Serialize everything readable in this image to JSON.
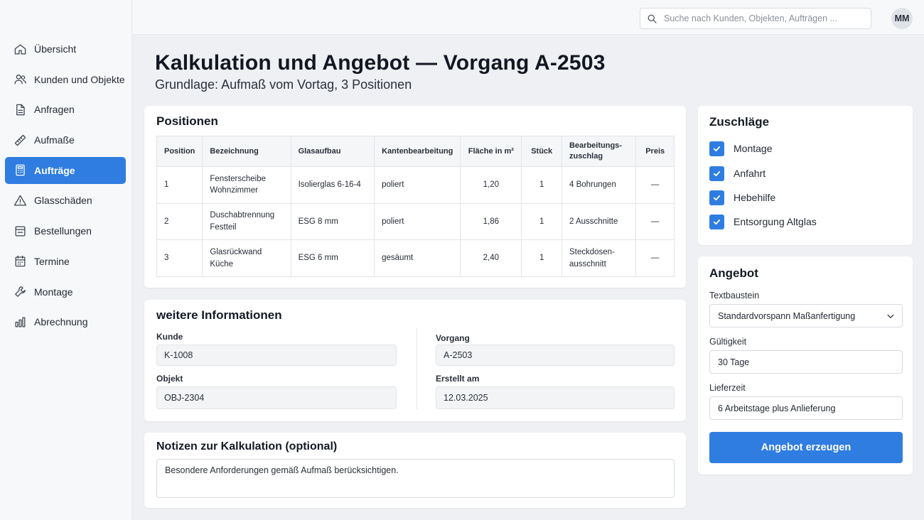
{
  "sidebar": {
    "items": [
      {
        "label": "Übersicht",
        "icon": "home-icon"
      },
      {
        "label": "Kunden und Objekte",
        "icon": "users-icon"
      },
      {
        "label": "Anfragen",
        "icon": "document-icon"
      },
      {
        "label": "Aufmaße",
        "icon": "ruler-icon"
      },
      {
        "label": "Aufträge",
        "icon": "calculator-icon",
        "active": true
      },
      {
        "label": "Glasschäden",
        "icon": "warning-icon"
      },
      {
        "label": "Bestellungen",
        "icon": "order-icon"
      },
      {
        "label": "Termine",
        "icon": "calendar-icon"
      },
      {
        "label": "Montage",
        "icon": "wrench-icon"
      },
      {
        "label": "Abrechnung",
        "icon": "bar-chart-icon"
      }
    ]
  },
  "topbar": {
    "search_placeholder": "Suche nach Kunden, Objekten, Aufträgen ...",
    "avatar_initials": "MM"
  },
  "header": {
    "title": "Kalkulation und Angebot — Vorgang A-2503",
    "subtitle": "Grundlage: Aufmaß vom Vortag, 3 Positionen"
  },
  "positions": {
    "title": "Positionen",
    "columns": [
      "Position",
      "Bezeichnung",
      "Glasaufbau",
      "Kantenbearbeitung",
      "Fläche in m²",
      "Stück",
      "Bearbeitungs-\nzuschlag",
      "Preis"
    ],
    "rows": [
      [
        "1",
        "Fensterscheibe\nWohnzimmer",
        "Isolierglas 6-16-4",
        "poliert",
        "1,20",
        "1",
        "4 Bohrungen",
        "—"
      ],
      [
        "2",
        "Duschabtrennung\nFestteil",
        "ESG 8 mm",
        "poliert",
        "1,86",
        "1",
        "2 Ausschnitte",
        "—"
      ],
      [
        "3",
        "Glasrückwand Küche",
        "ESG 6 mm",
        "gesäumt",
        "2,40",
        "1",
        "Steckdosen-\nausschnitt",
        "—"
      ]
    ]
  },
  "info": {
    "title": "weitere Informationen",
    "kunde_label": "Kunde",
    "kunde_value": "K-1008",
    "objekt_label": "Objekt",
    "objekt_value": "OBJ-2304",
    "vorgang_label": "Vorgang",
    "vorgang_value": "A-2503",
    "erstellt_label": "Erstellt am",
    "erstellt_value": "12.03.2025"
  },
  "notes": {
    "title": "Notizen zur Kalkulation (optional)",
    "value": "Besondere Anforderungen gemäß Aufmaß berücksichtigen."
  },
  "zuschlaege": {
    "title": "Zuschläge",
    "items": [
      {
        "label": "Montage",
        "checked": true
      },
      {
        "label": "Anfahrt",
        "checked": true
      },
      {
        "label": "Hebehilfe",
        "checked": true
      },
      {
        "label": "Entsorgung Altglas",
        "checked": true
      }
    ]
  },
  "angebot": {
    "title": "Angebot",
    "textbaustein_label": "Textbaustein",
    "textbaustein_value": "Standardvorspann Maßanfertigung",
    "gueltigkeit_label": "Gültigkeit",
    "gueltigkeit_value": "30 Tage",
    "lieferzeit_label": "Lieferzeit",
    "lieferzeit_value": "6 Arbeitstage plus Anlieferung",
    "button_label": "Angebot erzeugen"
  },
  "colors": {
    "accent": "#2f7de0",
    "background": "#eef0f3",
    "sidebar": "#f7f8fa"
  }
}
